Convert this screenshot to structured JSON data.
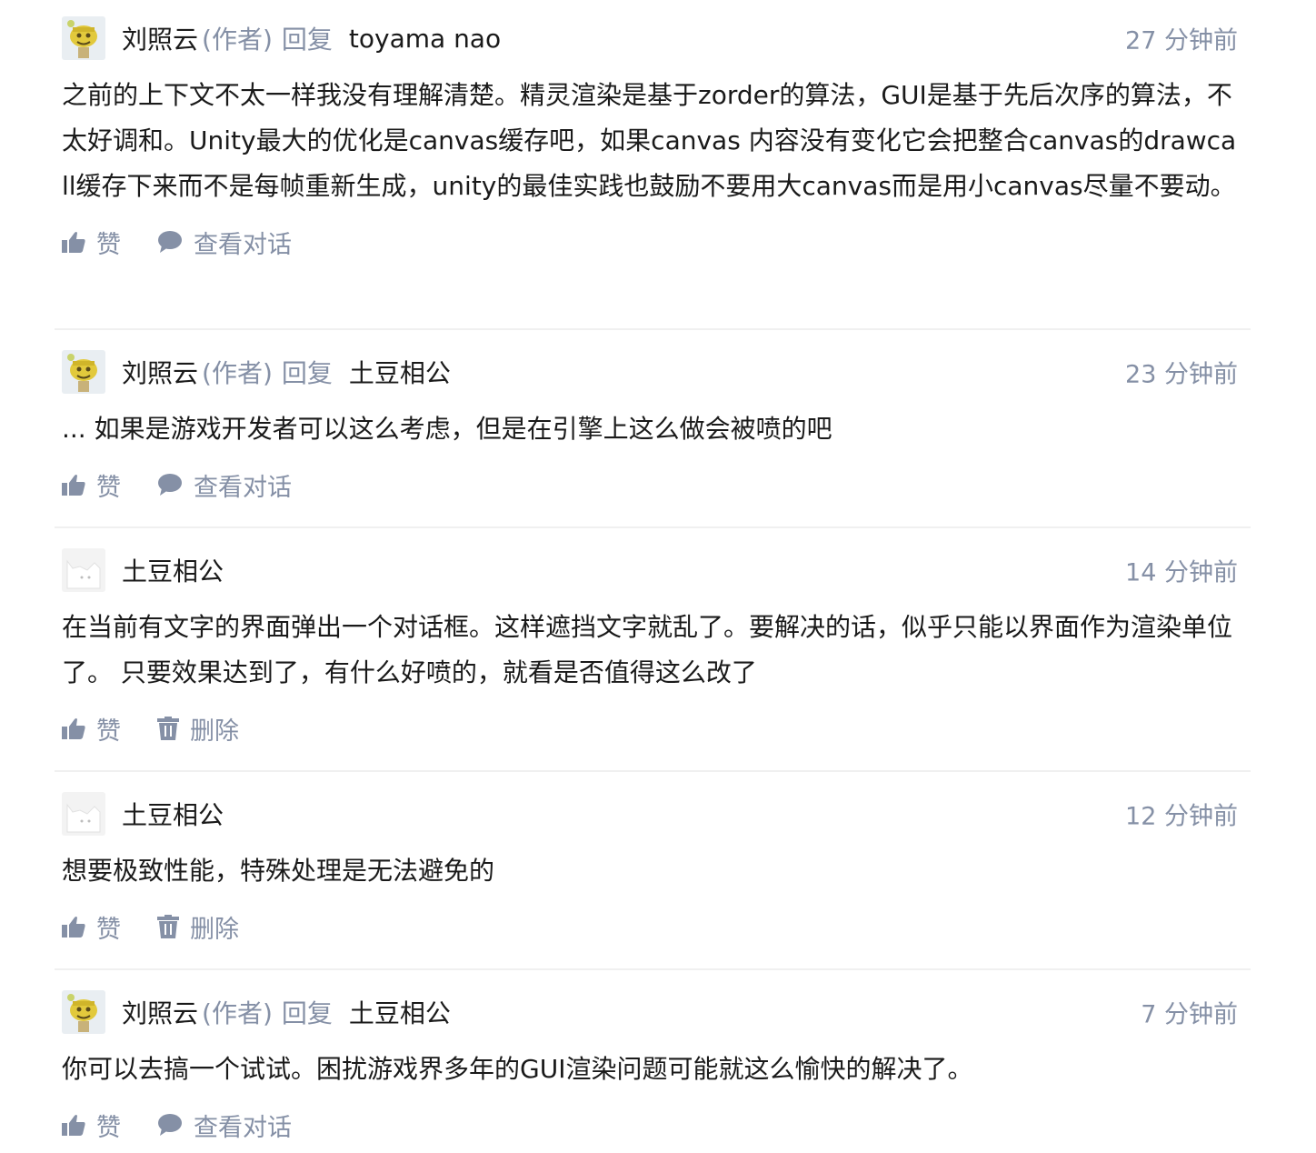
{
  "comments": [
    {
      "author": "刘照云",
      "author_tag": "(作者)",
      "reply_word": "回复",
      "reply_to": "toyama nao",
      "time": "27 分钟前",
      "text": "之前的上下文不太一样我没有理解清楚。精灵渲染是基于zorder的算法，GUI是基于先后次序的算法，不太好调和。Unity最大的优化是canvas缓存吧，如果canvas 内容没有变化它会把整合canvas的drawcall缓存下来而不是每帧重新生成，unity的最佳实践也鼓励不要用大canvas而是用小canvas尽量不要动。",
      "like_label": "赞",
      "secondary_label": "查看对话",
      "secondary_icon": "chat-bubble-icon"
    },
    {
      "author": "刘照云",
      "author_tag": "(作者)",
      "reply_word": "回复",
      "reply_to": "土豆相公",
      "time": "23 分钟前",
      "text": "... 如果是游戏开发者可以这么考虑，但是在引擎上这么做会被喷的吧",
      "like_label": "赞",
      "secondary_label": "查看对话",
      "secondary_icon": "chat-bubble-icon"
    },
    {
      "author": "土豆相公",
      "time": "14 分钟前",
      "text": "在当前有文字的界面弹出一个对话框。这样遮挡文字就乱了。要解决的话，似乎只能以界面作为渲染单位了。 只要效果达到了，有什么好喷的，就看是否值得这么改了",
      "like_label": "赞",
      "secondary_label": "删除",
      "secondary_icon": "trash-icon"
    },
    {
      "author": "土豆相公",
      "time": "12 分钟前",
      "text": "想要极致性能，特殊处理是无法避免的",
      "like_label": "赞",
      "secondary_label": "删除",
      "secondary_icon": "trash-icon"
    },
    {
      "author": "刘照云",
      "author_tag": "(作者)",
      "reply_word": "回复",
      "reply_to": "土豆相公",
      "time": "7 分钟前",
      "text": "你可以去搞一个试试。困扰游戏界多年的GUI渲染问题可能就这么愉快的解决了。",
      "like_label": "赞",
      "secondary_label": "查看对话",
      "secondary_icon": "chat-bubble-icon"
    }
  ],
  "colors": {
    "meta_gray": "#8590a6",
    "text": "#1a1a1a",
    "divider": "#f0f0f0"
  }
}
